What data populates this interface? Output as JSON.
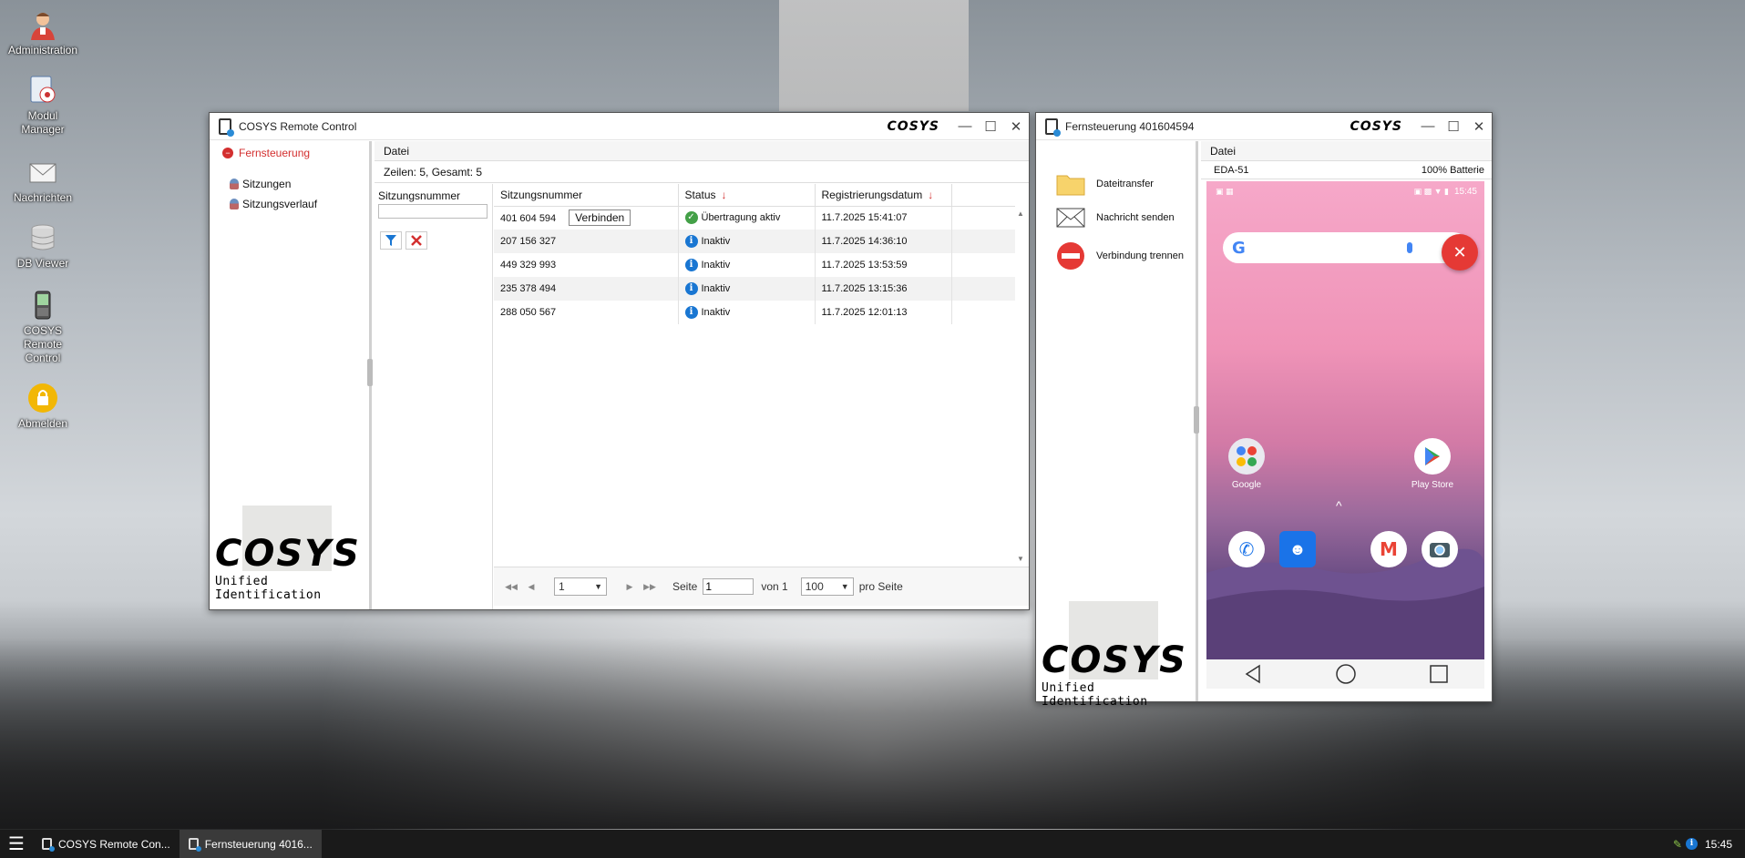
{
  "desktop": {
    "icons": [
      {
        "label": "Administration"
      },
      {
        "label": "Modul Manager"
      },
      {
        "label": "Nachrichten"
      },
      {
        "label": "DB Viewer"
      },
      {
        "label": "COSYS Remote Control"
      },
      {
        "label": "Abmelden"
      }
    ]
  },
  "remote_window": {
    "title": "COSYS Remote Control",
    "brand": "COSYS",
    "sidebar": {
      "header": "Fernsteuerung",
      "items": [
        {
          "label": "Sitzungen"
        },
        {
          "label": "Sitzungsverlauf"
        }
      ]
    },
    "logo_text": "COSYS",
    "logo_sub": "Unified Identification",
    "menu": {
      "datei": "Datei"
    },
    "rows_info": "Zeilen: 5, Gesamt: 5",
    "filter": {
      "label": "Sitzungsnummer",
      "value": ""
    },
    "table": {
      "headers": {
        "session": "Sitzungsnummer",
        "status": "Status",
        "date": "Registrierungsdatum"
      },
      "connect_label": "Verbinden",
      "rows": [
        {
          "session": "401 604 594",
          "status": "Übertragung aktiv",
          "status_kind": "ok",
          "date": "11.7.2025 15:41:07"
        },
        {
          "session": "207 156 327",
          "status": "Inaktiv",
          "status_kind": "info",
          "date": "11.7.2025 14:36:10"
        },
        {
          "session": "449 329 993",
          "status": "Inaktiv",
          "status_kind": "info",
          "date": "11.7.2025 13:53:59"
        },
        {
          "session": "235 378 494",
          "status": "Inaktiv",
          "status_kind": "info",
          "date": "11.7.2025 13:15:36"
        },
        {
          "session": "288 050 567",
          "status": "Inaktiv",
          "status_kind": "info",
          "date": "11.7.2025 12:01:13"
        }
      ]
    },
    "pager": {
      "page_select": "1",
      "seite_label": "Seite",
      "page_value": "1",
      "von_label": "von 1",
      "per_page": "100",
      "pro_seite_label": "pro Seite"
    }
  },
  "fern_window": {
    "title": "Fernsteuerung 401604594",
    "brand": "COSYS",
    "actions": [
      {
        "label": "Dateitransfer"
      },
      {
        "label": "Nachricht senden"
      },
      {
        "label": "Verbindung trennen"
      }
    ],
    "logo_text": "COSYS",
    "logo_sub": "Unified Identification",
    "menu": {
      "datei": "Datei"
    },
    "device": {
      "name": "EDA-51",
      "battery": "100% Batterie"
    },
    "phone": {
      "time": "15:45",
      "apps": [
        {
          "label": "Google"
        },
        {
          "label": "Play Store"
        }
      ]
    }
  },
  "taskbar": {
    "items": [
      {
        "label": "COSYS Remote Con..."
      },
      {
        "label": "Fernsteuerung 4016..."
      }
    ],
    "clock": "15:45"
  }
}
